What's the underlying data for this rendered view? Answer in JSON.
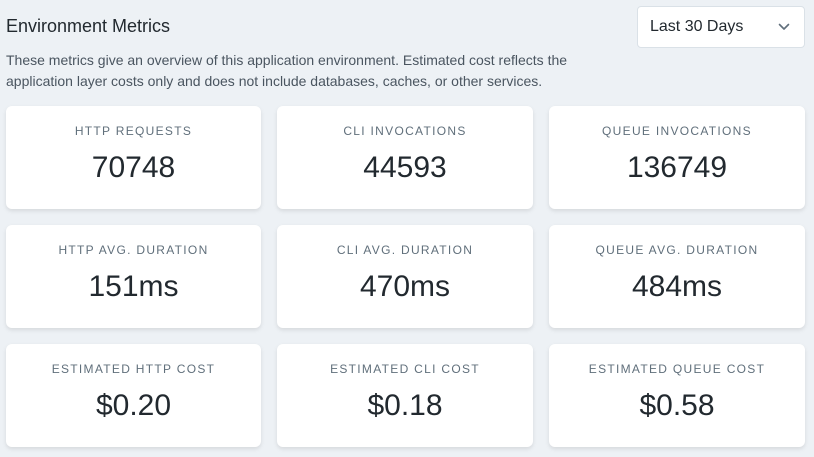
{
  "header": {
    "title": "Environment Metrics",
    "description": "These metrics give an overview of this application environment. Estimated cost reflects the application layer costs only and does not include databases, caches, or other services."
  },
  "range_select": {
    "selected": "Last 30 Days",
    "icon": "chevron-down-icon"
  },
  "metrics": [
    {
      "label": "HTTP REQUESTS",
      "value": "70748"
    },
    {
      "label": "CLI INVOCATIONS",
      "value": "44593"
    },
    {
      "label": "QUEUE INVOCATIONS",
      "value": "136749"
    },
    {
      "label": "HTTP AVG. DURATION",
      "value": "151ms"
    },
    {
      "label": "CLI AVG. DURATION",
      "value": "470ms"
    },
    {
      "label": "QUEUE AVG. DURATION",
      "value": "484ms"
    },
    {
      "label": "ESTIMATED HTTP COST",
      "value": "$0.20"
    },
    {
      "label": "ESTIMATED CLI COST",
      "value": "$0.18"
    },
    {
      "label": "ESTIMATED QUEUE COST",
      "value": "$0.58"
    }
  ]
}
